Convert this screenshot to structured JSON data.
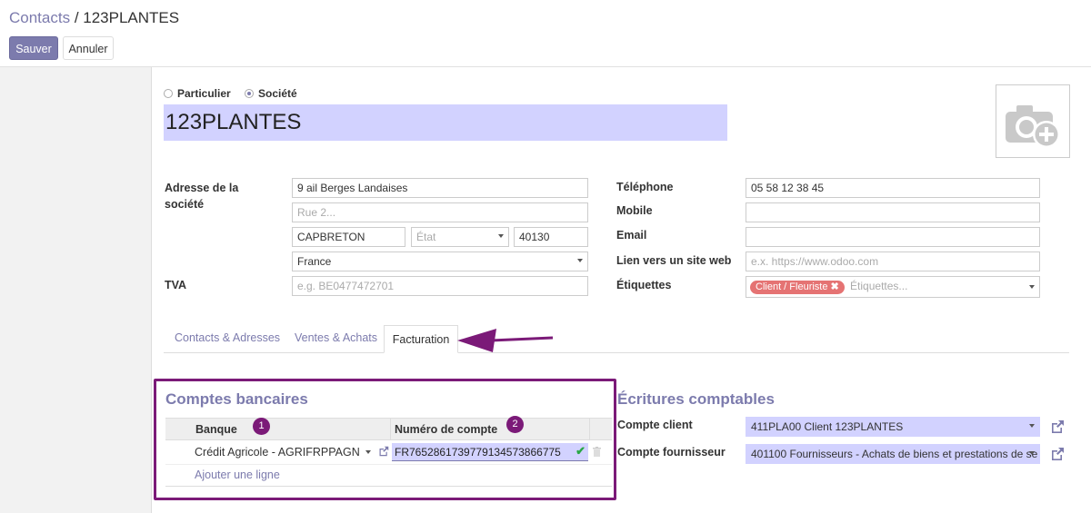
{
  "header": {
    "breadcrumb_parent": "Contacts",
    "breadcrumb_sep": " / ",
    "breadcrumb_current": "123PLANTES",
    "save_label": "Sauver",
    "cancel_label": "Annuler"
  },
  "company_type": {
    "individual_label": "Particulier",
    "company_label": "Société",
    "selected": "Société"
  },
  "name": "123PLANTES",
  "address": {
    "label": "Adresse de la société",
    "street": "9 ail Berges Landaises",
    "street2_placeholder": "Rue 2...",
    "city": "CAPBRETON",
    "state_placeholder": "État",
    "zip": "40130",
    "country": "France"
  },
  "vat": {
    "label": "TVA",
    "placeholder": "e.g. BE0477472701"
  },
  "contact": {
    "phone_label": "Téléphone",
    "phone": "05 58 12 38 45",
    "mobile_label": "Mobile",
    "email_label": "Email",
    "website_label": "Lien vers un site web",
    "website_placeholder": "e.x. https://www.odoo.com",
    "tags_label": "Étiquettes",
    "tag": "Client / Fleuriste",
    "tags_placeholder": "Étiquettes..."
  },
  "tabs": [
    "Contacts & Adresses",
    "Ventes & Achats",
    "Facturation"
  ],
  "active_tab": "Facturation",
  "bank": {
    "title": "Comptes bancaires",
    "col_bank": "Banque",
    "col_account": "Numéro de compte",
    "badge1": "1",
    "badge2": "2",
    "row_bank": "Crédit Agricole - AGRIFRPPAGN",
    "row_account": "FR7652861739779134573866775",
    "add_line": "Ajouter une ligne"
  },
  "accounting": {
    "title": "Écritures comptables",
    "client_label": "Compte client",
    "client_value": "411PLA00 Client 123PLANTES",
    "supplier_label": "Compte fournisseur",
    "supplier_value": "401100 Fournisseurs - Achats de biens et prestations de se"
  },
  "colors": {
    "brand": "#7c7bad",
    "highlight_box": "#7b1a78",
    "required_field": "#d2d2ff",
    "tag": "#e57373",
    "success_check": "#28a745"
  }
}
